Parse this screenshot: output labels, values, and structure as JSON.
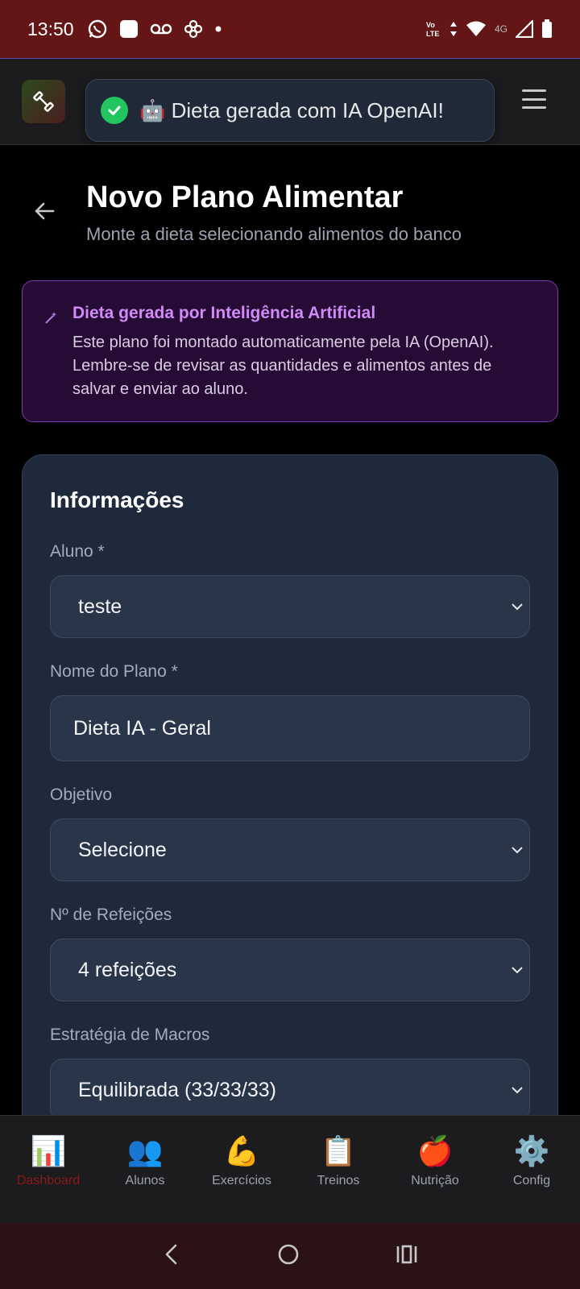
{
  "status_bar": {
    "time": "13:50",
    "network": "4G",
    "volte": "Vo LTE"
  },
  "toast": {
    "message": "🤖 Dieta gerada com IA OpenAI!"
  },
  "page": {
    "title": "Novo Plano Alimentar",
    "subtitle": "Monte a dieta selecionando alimentos do banco"
  },
  "ai_notice": {
    "title": "Dieta gerada por Inteligência Artificial",
    "text": "Este plano foi montado automaticamente pela IA (OpenAI). Lembre-se de revisar as quantidades e alimentos antes de salvar e enviar ao aluno."
  },
  "form": {
    "title": "Informações",
    "fields": [
      {
        "label": "Aluno *",
        "value": "teste",
        "type": "select"
      },
      {
        "label": "Nome do Plano *",
        "value": "Dieta IA - Geral",
        "type": "input"
      },
      {
        "label": "Objetivo",
        "value": "Selecione",
        "type": "select"
      },
      {
        "label": "Nº de Refeições",
        "value": "4 refeições",
        "type": "select"
      },
      {
        "label": "Estratégia de Macros",
        "value": "Equilibrada (33/33/33)",
        "type": "select"
      }
    ]
  },
  "bottom_nav": {
    "items": [
      {
        "emoji": "📊",
        "label": "Dashboard",
        "active": true
      },
      {
        "emoji": "👥",
        "label": "Alunos"
      },
      {
        "emoji": "💪",
        "label": "Exercícios"
      },
      {
        "emoji": "📋",
        "label": "Treinos"
      },
      {
        "emoji": "🍎",
        "label": "Nutrição"
      },
      {
        "emoji": "⚙️",
        "label": "Config"
      }
    ]
  },
  "colors": {
    "status_bar": "#641616",
    "accent_purple": "#d08bf7",
    "card_bg": "#1e293b",
    "toast_check": "#22c55e"
  }
}
